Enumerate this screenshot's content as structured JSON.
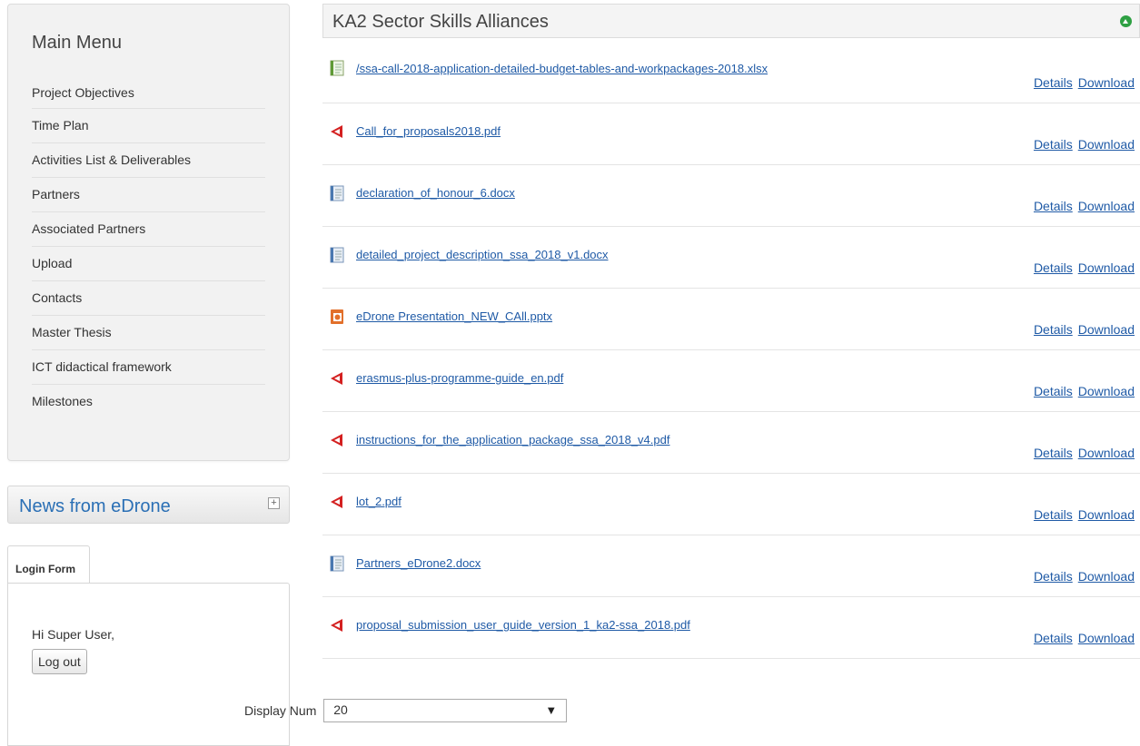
{
  "sidebar": {
    "menu_title": "Main Menu",
    "items": [
      {
        "label": "Project Objectives"
      },
      {
        "label": "Time Plan"
      },
      {
        "label": "Activities List & Deliverables"
      },
      {
        "label": "Partners"
      },
      {
        "label": "Associated Partners"
      },
      {
        "label": "Upload"
      },
      {
        "label": "Contacts"
      },
      {
        "label": "Master Thesis"
      },
      {
        "label": "ICT didactical framework"
      },
      {
        "label": "Milestones"
      }
    ],
    "news_title": "News from eDrone",
    "news_toggle": "+",
    "login": {
      "tab_label": "Login Form",
      "greeting": "Hi Super User,",
      "logout_label": "Log out"
    }
  },
  "main": {
    "category_title": "KA2 Sector Skills Alliances",
    "details_label": "Details",
    "download_label": "Download",
    "files": [
      {
        "name": "/ssa-call-2018-application-detailed-budget-tables-and-workpackages-2018.xlsx",
        "icon": "spreadsheet-icon"
      },
      {
        "name": "Call_for_proposals2018.pdf",
        "icon": "pdf-icon"
      },
      {
        "name": "declaration_of_honour_6.docx",
        "icon": "document-icon"
      },
      {
        "name": "detailed_project_description_ssa_2018_v1.docx",
        "icon": "document-icon"
      },
      {
        "name": "eDrone Presentation_NEW_CAll.pptx",
        "icon": "presentation-icon"
      },
      {
        "name": "erasmus-plus-programme-guide_en.pdf",
        "icon": "pdf-icon"
      },
      {
        "name": "instructions_for_the_application_package_ssa_2018_v4.pdf",
        "icon": "pdf-icon"
      },
      {
        "name": "lot_2.pdf",
        "icon": "pdf-icon"
      },
      {
        "name": "Partners_eDrone2.docx",
        "icon": "document-icon"
      },
      {
        "name": "proposal_submission_user_guide_version_1_ka2-ssa_2018.pdf",
        "icon": "pdf-icon"
      }
    ],
    "display_num_label": "Display Num",
    "display_num_value": "20",
    "colors": {
      "link": "#1f5aa6",
      "accent_green": "#2ea043",
      "pdf_red": "#d42020"
    }
  }
}
